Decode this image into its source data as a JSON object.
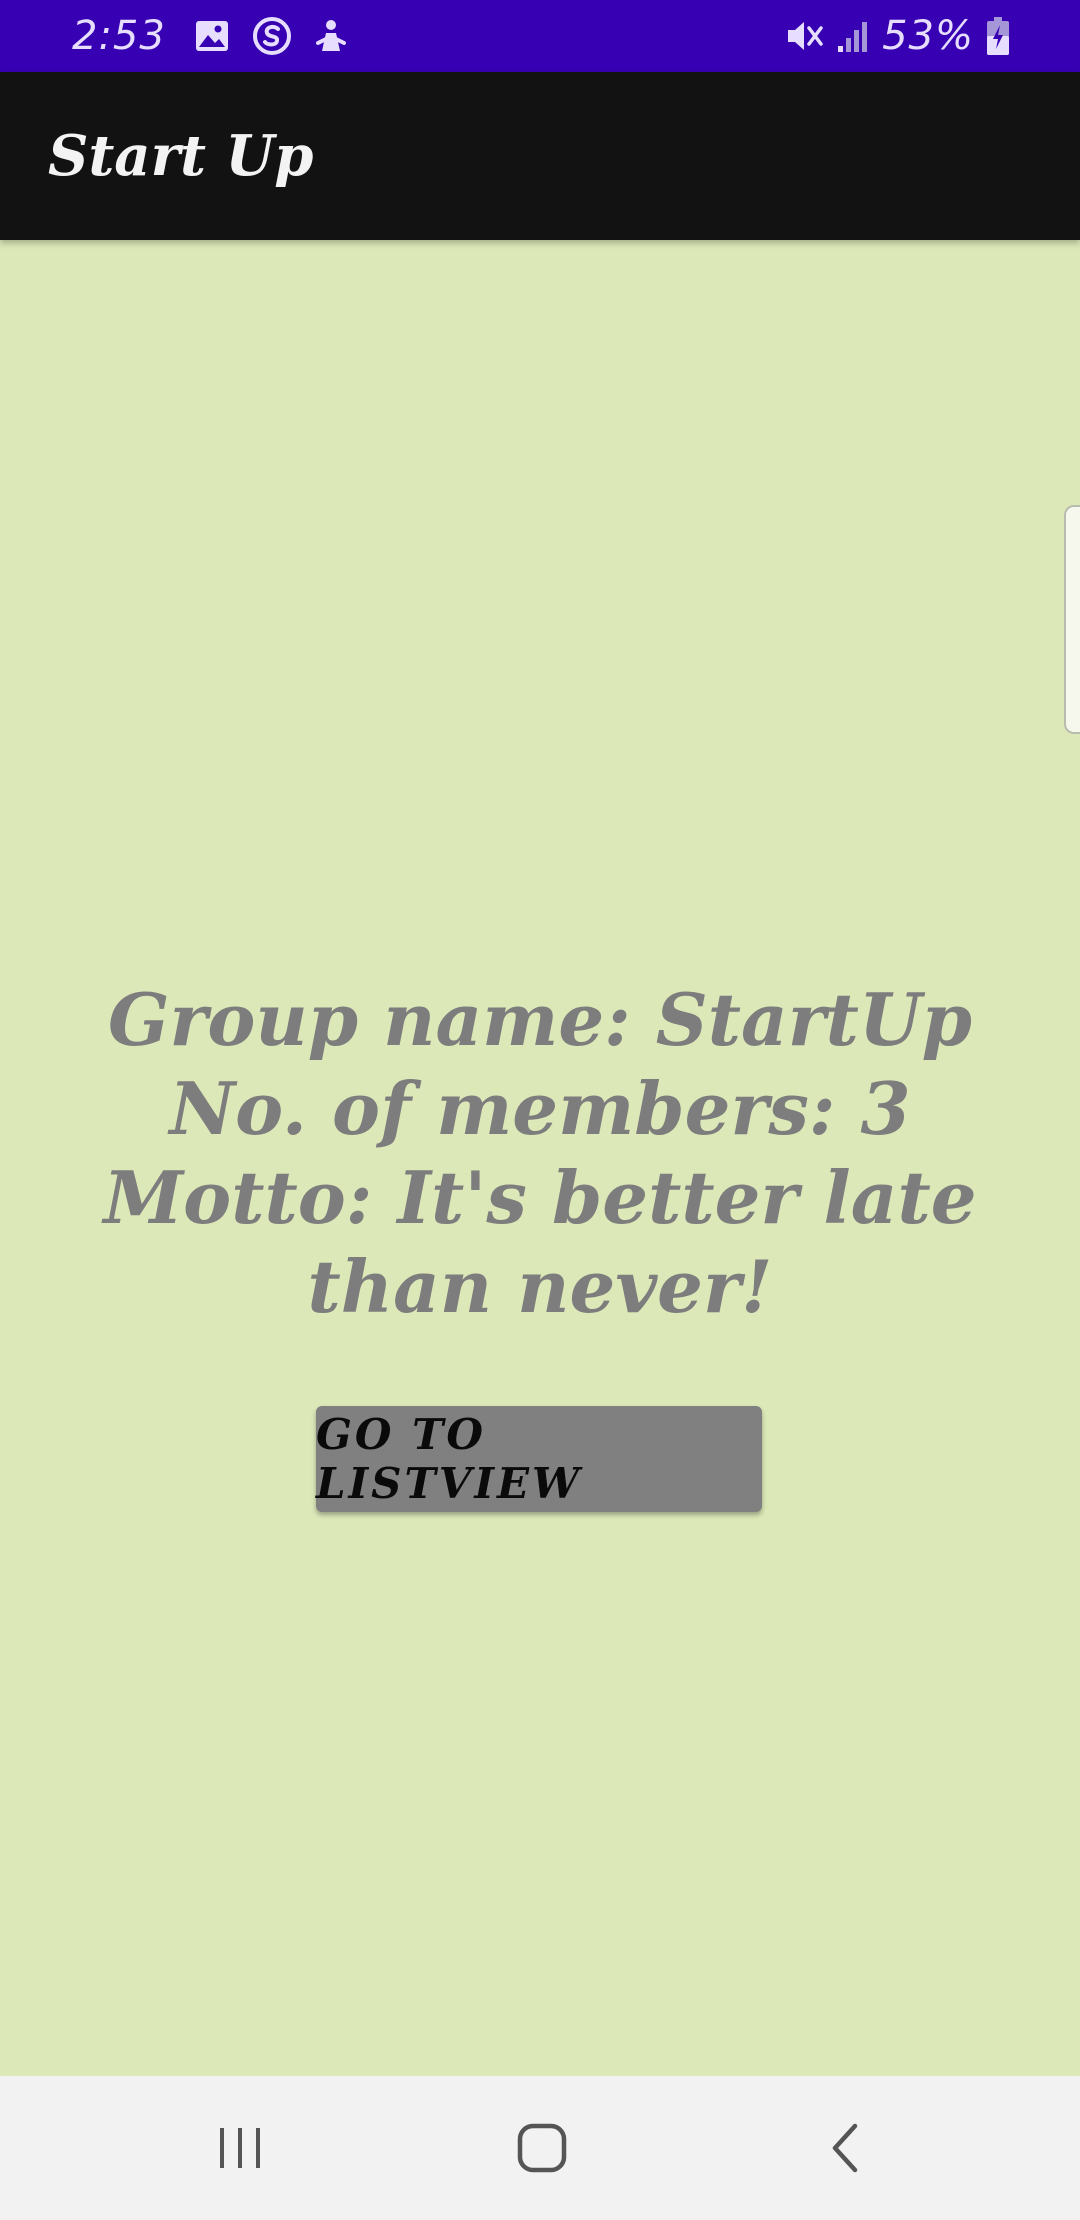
{
  "status_bar": {
    "time": "2:53",
    "battery_percent": "53%",
    "icons_left": [
      "gallery-icon",
      "s-icon",
      "notification-icon"
    ],
    "icons_right": [
      "mute-icon",
      "signal-icon",
      "battery-icon"
    ],
    "background_color": "#3700b3"
  },
  "app_bar": {
    "title": "Start Up",
    "background_color": "#121212"
  },
  "main": {
    "background_color": "#dce8b8",
    "group_name_line": "Group name: StartUp",
    "members_line": "No. of members: 3",
    "motto_line": "Motto: It's better late than never!",
    "button_label": "GO TO LISTVIEW"
  },
  "nav_bar": {
    "buttons": [
      "recent-apps-icon",
      "home-icon",
      "back-icon"
    ]
  }
}
